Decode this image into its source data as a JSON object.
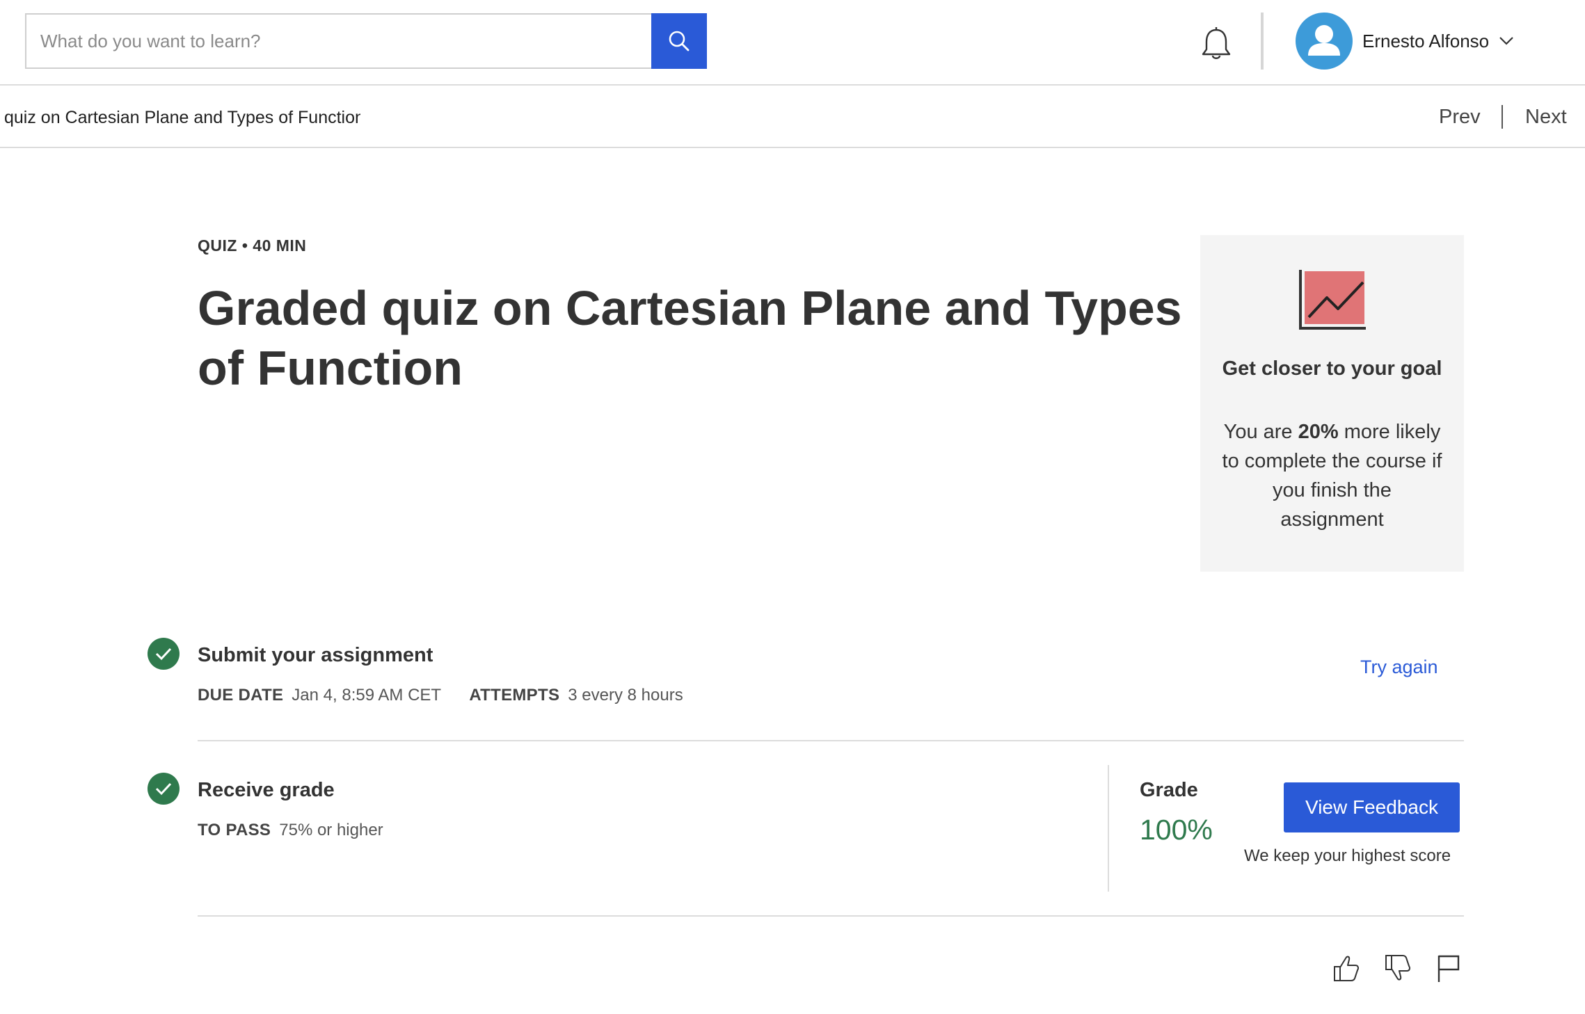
{
  "header": {
    "search": {
      "placeholder": "What do you want to learn?",
      "value": ""
    },
    "user": {
      "name": "Ernesto Alfonso"
    }
  },
  "subbar": {
    "breadcrumb": "quiz on Cartesian Plane and Types of Function",
    "prev_label": "Prev",
    "next_label": "Next"
  },
  "quiz": {
    "meta": "QUIZ • 40 MIN",
    "title": "Graded quiz on Cartesian Plane and Types of Function"
  },
  "goal_card": {
    "title": "Get closer to your goal",
    "text_before": "You are ",
    "text_bold": "20%",
    "text_after": " more likely to complete the course if you finish the assignment"
  },
  "submit_step": {
    "title": "Submit your assignment",
    "due_date_label": "DUE DATE",
    "due_date_value": "Jan 4, 8:59 AM CET",
    "attempts_label": "ATTEMPTS",
    "attempts_value": "3 every 8 hours",
    "try_again_label": "Try again"
  },
  "grade_step": {
    "title": "Receive grade",
    "to_pass_label": "TO PASS",
    "to_pass_value": "75% or higher",
    "grade_label": "Grade",
    "grade_value": "100%",
    "view_feedback_label": "View Feedback",
    "keep_note": "We keep your highest score"
  },
  "colors": {
    "accent": "#2a5ad7",
    "success": "#2f7a4d",
    "avatar": "#3d9bd9",
    "chart_fill": "#e07476"
  },
  "icons": {
    "search": "search-icon",
    "bell": "bell-icon",
    "avatar": "user-avatar-icon",
    "chevron": "chevron-down-icon",
    "chart": "trend-chart-icon",
    "check": "check-icon",
    "like": "thumbs-up-icon",
    "dislike": "thumbs-down-icon",
    "flag": "flag-icon"
  }
}
